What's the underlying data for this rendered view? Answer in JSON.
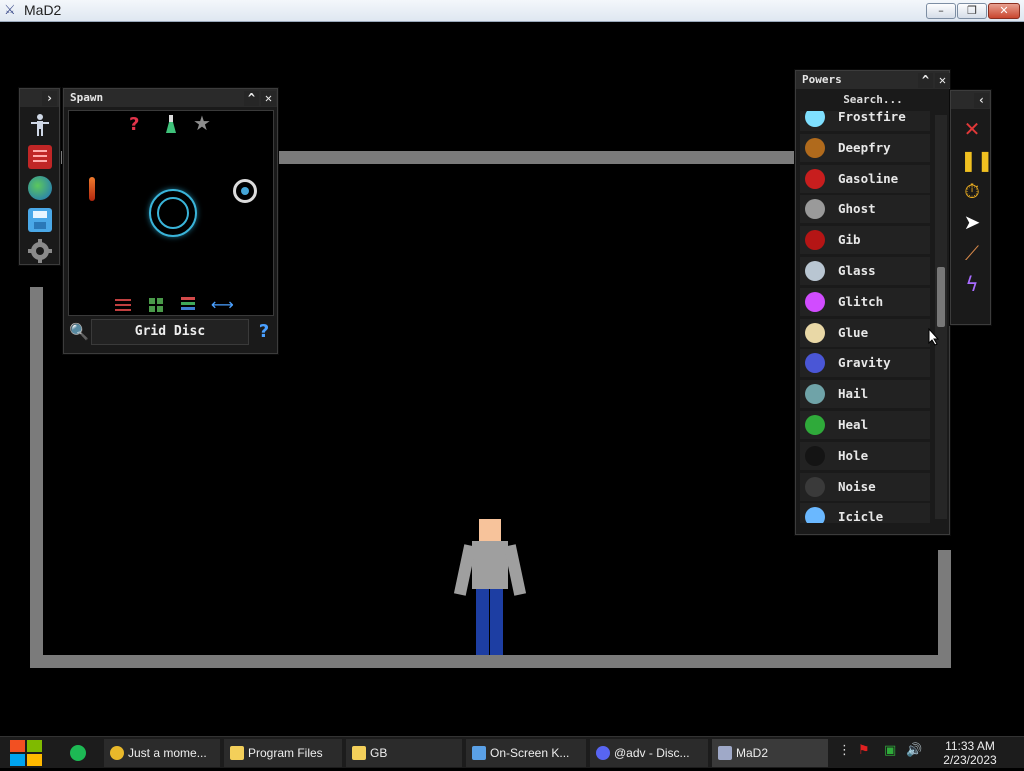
{
  "window": {
    "title": "MaD2",
    "min": "–",
    "max": "❐",
    "close": "✕"
  },
  "toolbar": {
    "expand": "›"
  },
  "spawn": {
    "title": "Spawn",
    "collapse": "^",
    "close": "✕",
    "selected": "Grid Disc",
    "help": "?"
  },
  "powers": {
    "title": "Powers",
    "collapse": "^",
    "close": "✕",
    "search_placeholder": "Search...",
    "items": [
      {
        "label": "Frostfire",
        "icon": "frostfire-icon",
        "color": "#7fe0ff"
      },
      {
        "label": "Deepfry",
        "icon": "drumstick-icon",
        "color": "#b06a1c"
      },
      {
        "label": "Gasoline",
        "icon": "gas-can-icon",
        "color": "#c81e1e"
      },
      {
        "label": "Ghost",
        "icon": "ghost-icon",
        "color": "#9a9a9a"
      },
      {
        "label": "Gib",
        "icon": "gib-icon",
        "color": "#b51515"
      },
      {
        "label": "Glass",
        "icon": "glass-icon",
        "color": "#b9c6d2"
      },
      {
        "label": "Glitch",
        "icon": "glitch-icon",
        "color": "#d14cff"
      },
      {
        "label": "Glue",
        "icon": "glue-bottle-icon",
        "color": "#e9d8a6"
      },
      {
        "label": "Gravity",
        "icon": "gravity-icon",
        "color": "#4a56d6"
      },
      {
        "label": "Hail",
        "icon": "hail-icon",
        "color": "#6fa3a8"
      },
      {
        "label": "Heal",
        "icon": "heal-icon",
        "color": "#2faa3a"
      },
      {
        "label": "Hole",
        "icon": "hole-icon",
        "color": "#141414"
      },
      {
        "label": "Noise",
        "icon": "noise-icon",
        "color": "#3a3a3a"
      },
      {
        "label": "Icicle",
        "icon": "icicle-icon",
        "color": "#6ab8ff"
      }
    ]
  },
  "right_tools": {
    "collapse": "‹"
  },
  "taskbar": {
    "items": [
      {
        "label": "Just a mome...",
        "icon": "chrome-icon"
      },
      {
        "label": "Program Files",
        "icon": "folder-icon"
      },
      {
        "label": "GB",
        "icon": "folder-icon"
      },
      {
        "label": "On-Screen K...",
        "icon": "keyboard-icon"
      },
      {
        "label": "@adv - Disc...",
        "icon": "discord-icon"
      },
      {
        "label": "MaD2",
        "icon": "mad2-icon"
      }
    ],
    "time": "11:33 AM",
    "date": "2/23/2023"
  }
}
